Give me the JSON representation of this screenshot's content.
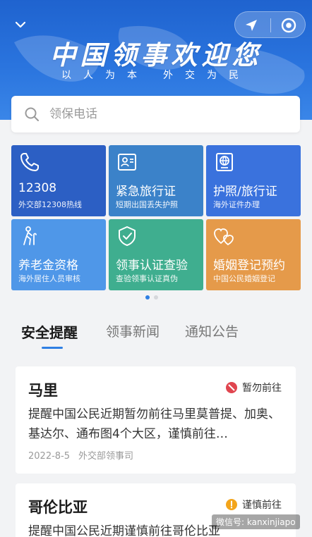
{
  "header": {
    "slogan_main": "中国领事欢迎您",
    "slogan_sub_left": "以人为本",
    "slogan_sub_right": "外交为民",
    "icons": [
      "chevron-down-icon",
      "navigation-arrow-icon",
      "target-icon"
    ]
  },
  "search": {
    "placeholder": "领保电话"
  },
  "tiles": [
    {
      "title": "12308",
      "subtitle": "外交部12308热线",
      "icon": "phone-icon",
      "color": "#2c5fc4"
    },
    {
      "title": "紧急旅行证",
      "subtitle": "短期出国丢失护照",
      "icon": "id-card-icon",
      "color": "#3b82c9"
    },
    {
      "title": "护照/旅行证",
      "subtitle": "海外证件办理",
      "icon": "passport-icon",
      "color": "#3a72dd"
    },
    {
      "title": "养老金资格",
      "subtitle": "海外居住人员审核",
      "icon": "elderly-icon",
      "color": "#4f97e8"
    },
    {
      "title": "领事认证查验",
      "subtitle": "查验领事认证真伪",
      "icon": "shield-check-icon",
      "color": "#3fae8f"
    },
    {
      "title": "婚姻登记预约",
      "subtitle": "中国公民婚姻登记",
      "icon": "hearts-icon",
      "color": "#e59a4a"
    }
  ],
  "tabs": [
    "安全提醒",
    "领事新闻",
    "通知公告"
  ],
  "cards": [
    {
      "country": "马里",
      "level": "暂勿前往",
      "level_color": "#e0454f",
      "desc": "提醒中国公民近期暂勿前往马里莫普提、加奥、基达尔、通布图4个大区，谨慎前往…",
      "date": "2022-8-5",
      "source": "外交部领事司"
    },
    {
      "country": "哥伦比亚",
      "level": "谨慎前往",
      "level_color": "#f3a51b",
      "desc": "提醒中国公民近期谨慎前往哥伦比亚",
      "date": "",
      "source": ""
    }
  ],
  "watermark": "微信号: kanxinjiapo"
}
